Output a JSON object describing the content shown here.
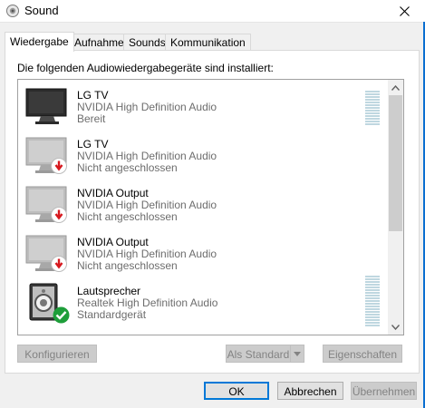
{
  "window": {
    "title": "Sound",
    "icons": {
      "app": "speaker-icon",
      "close": "close-icon"
    }
  },
  "tabs": [
    {
      "label": "Wiedergabe",
      "active": true
    },
    {
      "label": "Aufnahme",
      "active": false
    },
    {
      "label": "Sounds",
      "active": false
    },
    {
      "label": "Kommunikation",
      "active": false
    }
  ],
  "panel": {
    "label": "Die folgenden Audiowiedergabegeräte sind installiert:"
  },
  "devices": [
    {
      "name": "LG TV",
      "driver": "NVIDIA High Definition Audio",
      "status": "Bereit",
      "icon": "monitor-icon",
      "badge": ""
    },
    {
      "name": "LG TV",
      "driver": "NVIDIA High Definition Audio",
      "status": "Nicht angeschlossen",
      "icon": "monitor-icon",
      "badge": "disconnected-badge-icon"
    },
    {
      "name": "NVIDIA Output",
      "driver": "NVIDIA High Definition Audio",
      "status": "Nicht angeschlossen",
      "icon": "monitor-icon",
      "badge": "disconnected-badge-icon"
    },
    {
      "name": "NVIDIA Output",
      "driver": "NVIDIA High Definition Audio",
      "status": "Nicht angeschlossen",
      "icon": "monitor-icon",
      "badge": "disconnected-badge-icon"
    },
    {
      "name": "Lautsprecher",
      "driver": "Realtek High Definition Audio",
      "status": "Standardgerät",
      "icon": "speaker-device-icon",
      "badge": "default-check-icon"
    }
  ],
  "buttons": {
    "configure": "Konfigurieren",
    "set_default": "Als Standard",
    "properties": "Eigenschaften",
    "ok": "OK",
    "cancel": "Abbrechen",
    "apply": "Übernehmen"
  },
  "colors": {
    "accent": "#0078d7",
    "meter": "#bfd7e0",
    "disconnected": "#d7191f",
    "default_check": "#1e9e3a"
  }
}
